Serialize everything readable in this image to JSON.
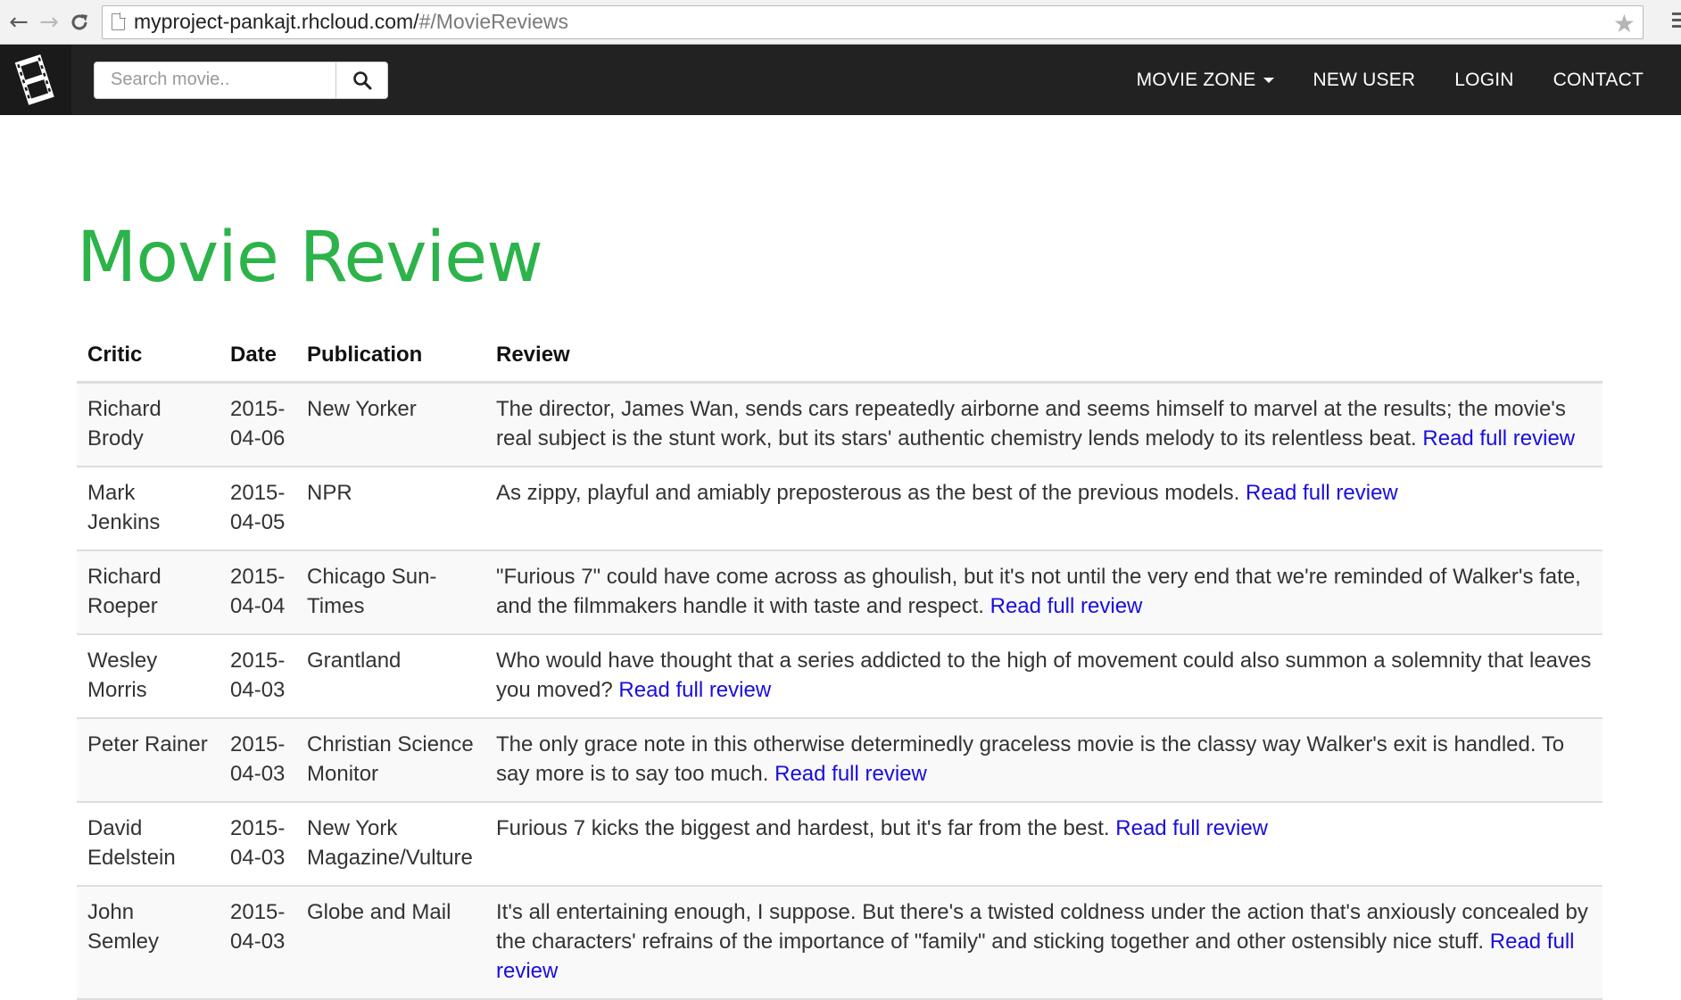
{
  "browser": {
    "url_host": "myproject-pankajt.rhcloud.com/",
    "url_path": "#/MovieReviews"
  },
  "navbar": {
    "search_placeholder": "Search movie..",
    "links": {
      "movie_zone": "MOVIE ZONE",
      "new_user": "NEW USER",
      "login": "LOGIN",
      "contact": "CONTACT"
    }
  },
  "main": {
    "title": "Movie Review",
    "table": {
      "headers": {
        "critic": "Critic",
        "date": "Date",
        "publication": "Publication",
        "review": "Review"
      },
      "link_label": "Read full review",
      "rows": [
        {
          "critic": "Richard Brody",
          "date": "2015-04-06",
          "publication": "New Yorker",
          "review": "The director, James Wan, sends cars repeatedly airborne and seems himself to marvel at the results; the movie's real subject is the stunt work, but its stars' authentic chemistry lends melody to its relentless beat."
        },
        {
          "critic": "Mark Jenkins",
          "date": "2015-04-05",
          "publication": "NPR",
          "review": "As zippy, playful and amiably preposterous as the best of the previous models."
        },
        {
          "critic": "Richard Roeper",
          "date": "2015-04-04",
          "publication": "Chicago Sun-Times",
          "review": "\"Furious 7\" could have come across as ghoulish, but it's not until the very end that we're reminded of Walker's fate, and the filmmakers handle it with taste and respect."
        },
        {
          "critic": "Wesley Morris",
          "date": "2015-04-03",
          "publication": "Grantland",
          "review": "Who would have thought that a series addicted to the high of movement could also summon a solemnity that leaves you moved?"
        },
        {
          "critic": "Peter Rainer",
          "date": "2015-04-03",
          "publication": "Christian Science Monitor",
          "review": "The only grace note in this otherwise determinedly graceless movie is the classy way Walker's exit is handled. To say more is to say too much."
        },
        {
          "critic": "David Edelstein",
          "date": "2015-04-03",
          "publication": "New York Magazine/Vulture",
          "review": "Furious 7 kicks the biggest and hardest, but it's far from the best."
        },
        {
          "critic": "John Semley",
          "date": "2015-04-03",
          "publication": "Globe and Mail",
          "review": "It's all entertaining enough, I suppose. But there's a twisted coldness under the action that's anxiously concealed by the characters' refrains of the importance of \"family\" and sticking together and other ostensibly nice stuff."
        }
      ]
    }
  }
}
